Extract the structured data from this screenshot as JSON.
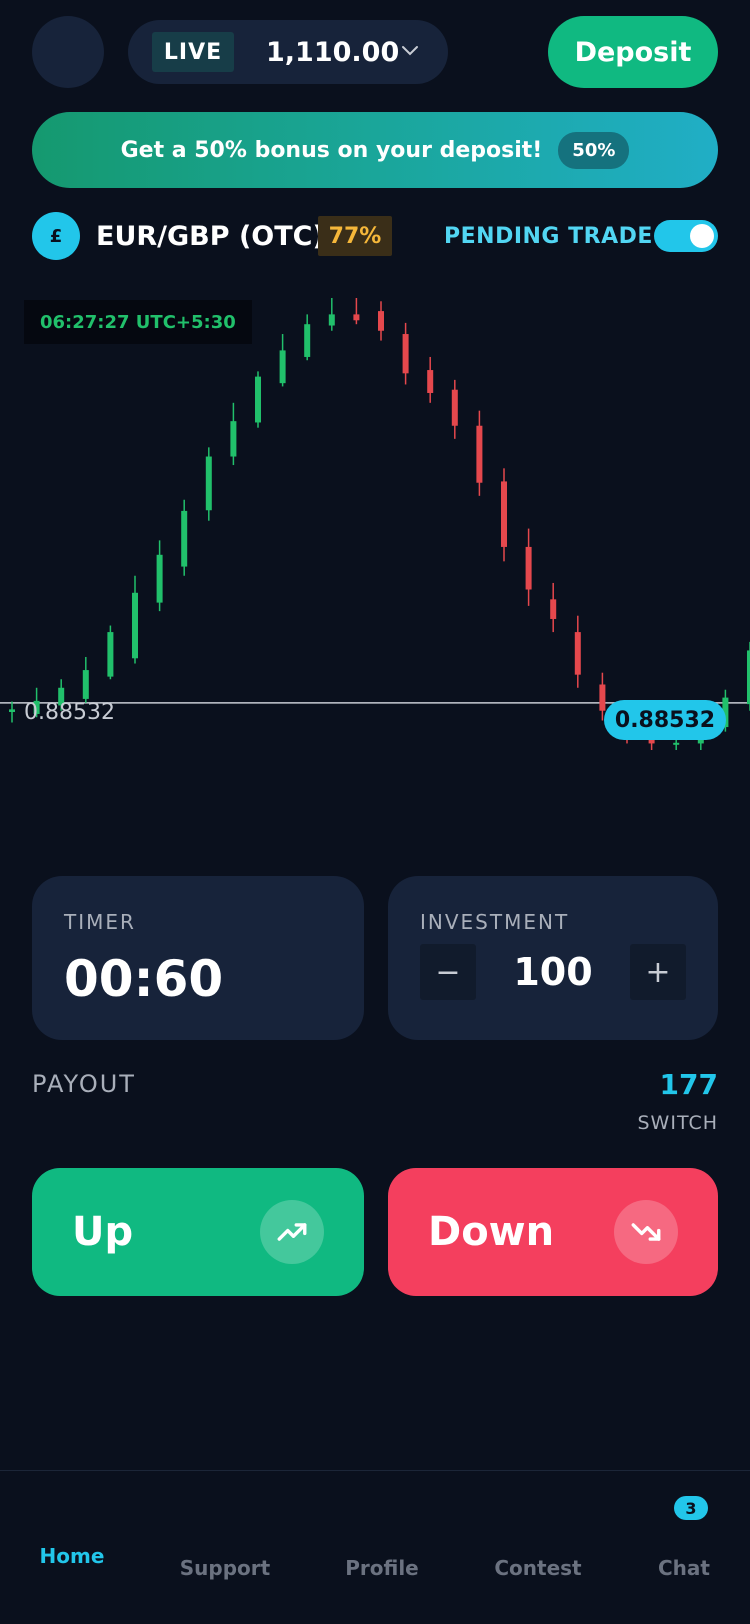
{
  "header": {
    "account_mode": "LIVE",
    "balance": "1,110.00",
    "deposit_label": "Deposit",
    "dropdown_icon": "chevron-down-icon"
  },
  "promo": {
    "text": "Get a 50% bonus on your deposit!",
    "badge": "50%"
  },
  "asset": {
    "icon_glyph": "£",
    "name": "EUR/GBP (OTC)",
    "payout_percent": "77%",
    "pending_trade_label": "PENDING TRADE",
    "pending_trade_enabled": true
  },
  "chart": {
    "time_label": "06:27:27 UTC+5:30",
    "current_price_left": "0.88532",
    "current_price_tag": "0.88532",
    "colors": {
      "up": "#21c06b",
      "down": "#e5484d",
      "price_line": "#c8ccd4"
    }
  },
  "chart_data": {
    "type": "candlestick",
    "current_price": 0.88532,
    "candles": [
      {
        "o": 0.88518,
        "h": 0.88534,
        "l": 0.88502,
        "c": 0.88522
      },
      {
        "o": 0.88515,
        "h": 0.88555,
        "l": 0.8851,
        "c": 0.88535
      },
      {
        "o": 0.88528,
        "h": 0.88568,
        "l": 0.8852,
        "c": 0.88555
      },
      {
        "o": 0.88538,
        "h": 0.88602,
        "l": 0.88532,
        "c": 0.88582
      },
      {
        "o": 0.88572,
        "h": 0.8865,
        "l": 0.88568,
        "c": 0.8864
      },
      {
        "o": 0.886,
        "h": 0.88726,
        "l": 0.88592,
        "c": 0.887
      },
      {
        "o": 0.88685,
        "h": 0.8878,
        "l": 0.88672,
        "c": 0.88758
      },
      {
        "o": 0.8874,
        "h": 0.88842,
        "l": 0.88726,
        "c": 0.88825
      },
      {
        "o": 0.88826,
        "h": 0.88922,
        "l": 0.8881,
        "c": 0.88908
      },
      {
        "o": 0.88908,
        "h": 0.8899,
        "l": 0.88895,
        "c": 0.88962
      },
      {
        "o": 0.8896,
        "h": 0.89038,
        "l": 0.88952,
        "c": 0.8903
      },
      {
        "o": 0.8902,
        "h": 0.89095,
        "l": 0.89015,
        "c": 0.8907
      },
      {
        "o": 0.8906,
        "h": 0.89125,
        "l": 0.89055,
        "c": 0.8911
      },
      {
        "o": 0.89108,
        "h": 0.8915,
        "l": 0.891,
        "c": 0.89125
      },
      {
        "o": 0.89125,
        "h": 0.8915,
        "l": 0.8911,
        "c": 0.89116
      },
      {
        "o": 0.8913,
        "h": 0.89145,
        "l": 0.89085,
        "c": 0.891
      },
      {
        "o": 0.89095,
        "h": 0.89112,
        "l": 0.89018,
        "c": 0.89035
      },
      {
        "o": 0.8904,
        "h": 0.8906,
        "l": 0.8899,
        "c": 0.89005
      },
      {
        "o": 0.8901,
        "h": 0.89025,
        "l": 0.88935,
        "c": 0.88955
      },
      {
        "o": 0.88955,
        "h": 0.88978,
        "l": 0.88848,
        "c": 0.88868
      },
      {
        "o": 0.8887,
        "h": 0.8889,
        "l": 0.88748,
        "c": 0.8877
      },
      {
        "o": 0.8877,
        "h": 0.88798,
        "l": 0.8868,
        "c": 0.88705
      },
      {
        "o": 0.8869,
        "h": 0.88715,
        "l": 0.8864,
        "c": 0.8866
      },
      {
        "o": 0.8864,
        "h": 0.88665,
        "l": 0.88555,
        "c": 0.88575
      },
      {
        "o": 0.8856,
        "h": 0.88578,
        "l": 0.88505,
        "c": 0.8852
      },
      {
        "o": 0.8852,
        "h": 0.88532,
        "l": 0.8847,
        "c": 0.8849
      },
      {
        "o": 0.88478,
        "h": 0.88495,
        "l": 0.8846,
        "c": 0.8847
      },
      {
        "o": 0.88468,
        "h": 0.88482,
        "l": 0.8846,
        "c": 0.88471
      },
      {
        "o": 0.8847,
        "h": 0.885,
        "l": 0.8846,
        "c": 0.8849
      },
      {
        "o": 0.88495,
        "h": 0.88552,
        "l": 0.88488,
        "c": 0.8854
      },
      {
        "o": 0.8853,
        "h": 0.88625,
        "l": 0.8852,
        "c": 0.88612
      }
    ]
  },
  "timer": {
    "label": "TIMER",
    "value": "00:60"
  },
  "investment": {
    "label": "INVESTMENT",
    "value": "100",
    "minus": "−",
    "plus": "+"
  },
  "payout": {
    "label": "PAYOUT",
    "value": "177",
    "switch_label": "SWITCH"
  },
  "trade": {
    "up_label": "Up",
    "up_icon": "trending-up-icon",
    "down_label": "Down",
    "down_icon": "trending-down-icon"
  },
  "nav": {
    "items": [
      {
        "label": "Home",
        "active": true
      },
      {
        "label": "Support"
      },
      {
        "label": "Profile"
      },
      {
        "label": "Contest"
      },
      {
        "label": "Chat"
      }
    ],
    "chat_badge": "3"
  }
}
